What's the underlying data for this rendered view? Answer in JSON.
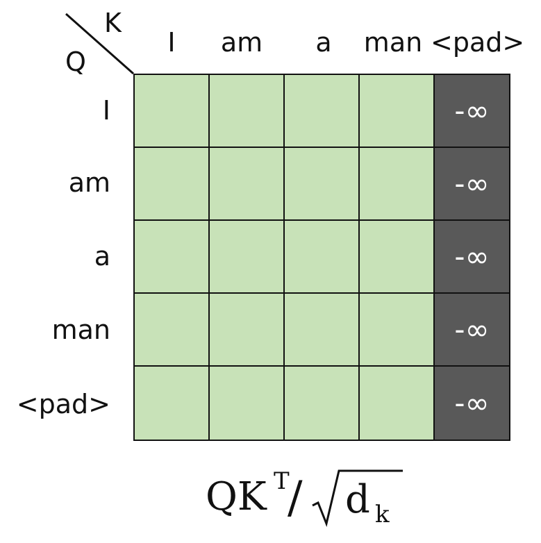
{
  "corner": {
    "k_label": "K",
    "q_label": "Q"
  },
  "columns": [
    "I",
    "am",
    "a",
    "man",
    "<pad>"
  ],
  "rows": [
    "I",
    "am",
    "a",
    "man",
    "<pad>"
  ],
  "mask": [
    [
      false,
      false,
      false,
      false,
      true
    ],
    [
      false,
      false,
      false,
      false,
      true
    ],
    [
      false,
      false,
      false,
      false,
      true
    ],
    [
      false,
      false,
      false,
      false,
      true
    ],
    [
      false,
      false,
      false,
      false,
      true
    ]
  ],
  "mask_value": "-∞",
  "colors": {
    "unmasked": "#c8e2b8",
    "masked": "#595959",
    "border": "#111111"
  },
  "formula": {
    "numerator": "QK",
    "superscript": "T",
    "slash": "/",
    "radicand": "d",
    "subscript": "k"
  }
}
